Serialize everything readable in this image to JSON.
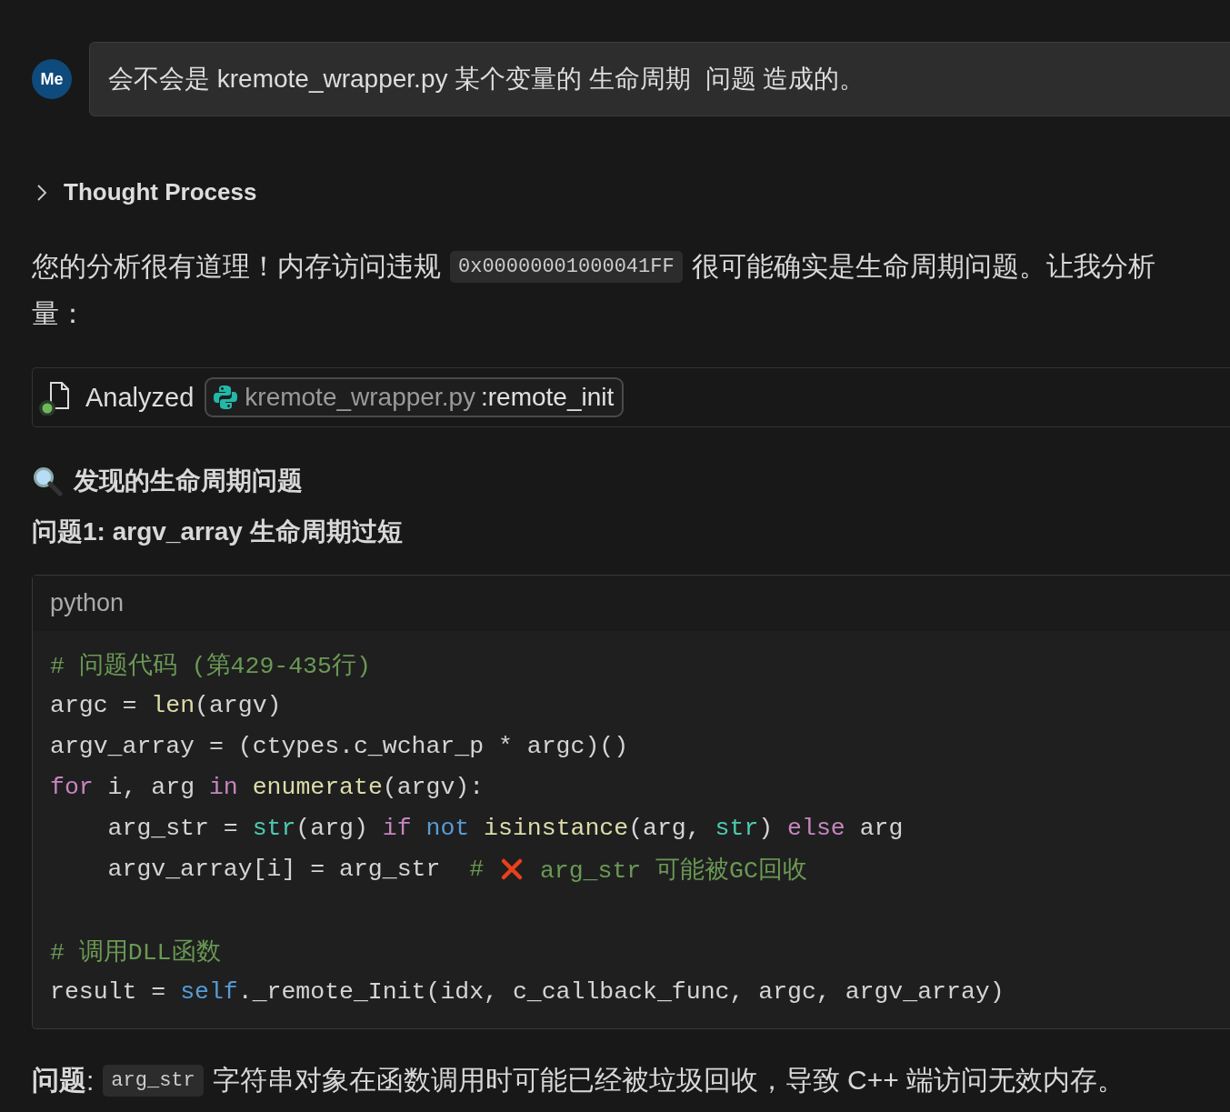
{
  "user_message": {
    "avatar": "Me",
    "text": "会不会是 kremote_wrapper.py 某个变量的 生命周期  问题 造成的。"
  },
  "thought_process": {
    "label": "Thought Process",
    "expanded": false
  },
  "intro_lines": [
    [
      {
        "kind": "text",
        "text": "您的分析很有道理！内存访问违规"
      },
      {
        "kind": "code",
        "text": "0x00000001000041FF"
      },
      {
        "kind": "text",
        "text": "很可能确实是生命周期问题。让我分析"
      }
    ],
    [
      {
        "kind": "text",
        "text": "量："
      }
    ]
  ],
  "analyzed": {
    "label": "Analyzed",
    "file": "kremote_wrapper.py",
    "symbol": ":remote_init"
  },
  "heading": "发现的生命周期问题",
  "subheading": "问题1: argv_array 生命周期过短",
  "code_block": {
    "language": "python",
    "lines": [
      [
        {
          "kind": "comment",
          "text": "# 问题代码 (第429-435行)"
        }
      ],
      [
        {
          "kind": "plain",
          "text": "argc = "
        },
        {
          "kind": "func",
          "text": "len"
        },
        {
          "kind": "plain",
          "text": "(argv)"
        }
      ],
      [
        {
          "kind": "plain",
          "text": "argv_array = (ctypes.c_wchar_p * argc)()"
        }
      ],
      [
        {
          "kind": "keyword",
          "text": "for"
        },
        {
          "kind": "plain",
          "text": " i, arg "
        },
        {
          "kind": "keyword",
          "text": "in"
        },
        {
          "kind": "func",
          "text": " enumerate"
        },
        {
          "kind": "plain",
          "text": "(argv):"
        }
      ],
      [
        {
          "kind": "plain",
          "text": "    arg_str = "
        },
        {
          "kind": "builtin",
          "text": "str"
        },
        {
          "kind": "plain",
          "text": "(arg) "
        },
        {
          "kind": "keyword",
          "text": "if"
        },
        {
          "kind": "self",
          "text": " not"
        },
        {
          "kind": "func",
          "text": " isinstance"
        },
        {
          "kind": "plain",
          "text": "(arg, "
        },
        {
          "kind": "builtin",
          "text": "str"
        },
        {
          "kind": "plain",
          "text": ") "
        },
        {
          "kind": "keyword",
          "text": "else"
        },
        {
          "kind": "plain",
          "text": " arg"
        }
      ],
      [
        {
          "kind": "plain",
          "text": "    argv_array[i] = arg_str  "
        },
        {
          "kind": "comment",
          "text": "# "
        },
        {
          "kind": "cross"
        },
        {
          "kind": "comment",
          "text": " arg_str 可能被GC回收"
        }
      ],
      [
        {
          "kind": "gap"
        },
        {
          "kind": "comment",
          "text": "# 调用DLL函数"
        }
      ],
      [
        {
          "kind": "plain",
          "text": "result = "
        },
        {
          "kind": "self",
          "text": "self"
        },
        {
          "kind": "plain",
          "text": "._remote_Init(idx, c_callback_func, argc, argv_array)"
        }
      ]
    ]
  },
  "problem": {
    "label": "问题",
    "colon": ":",
    "code": "arg_str",
    "text": "字符串对象在函数调用时可能已经被垃圾回收，导致 C++ 端访问无效内存。"
  }
}
